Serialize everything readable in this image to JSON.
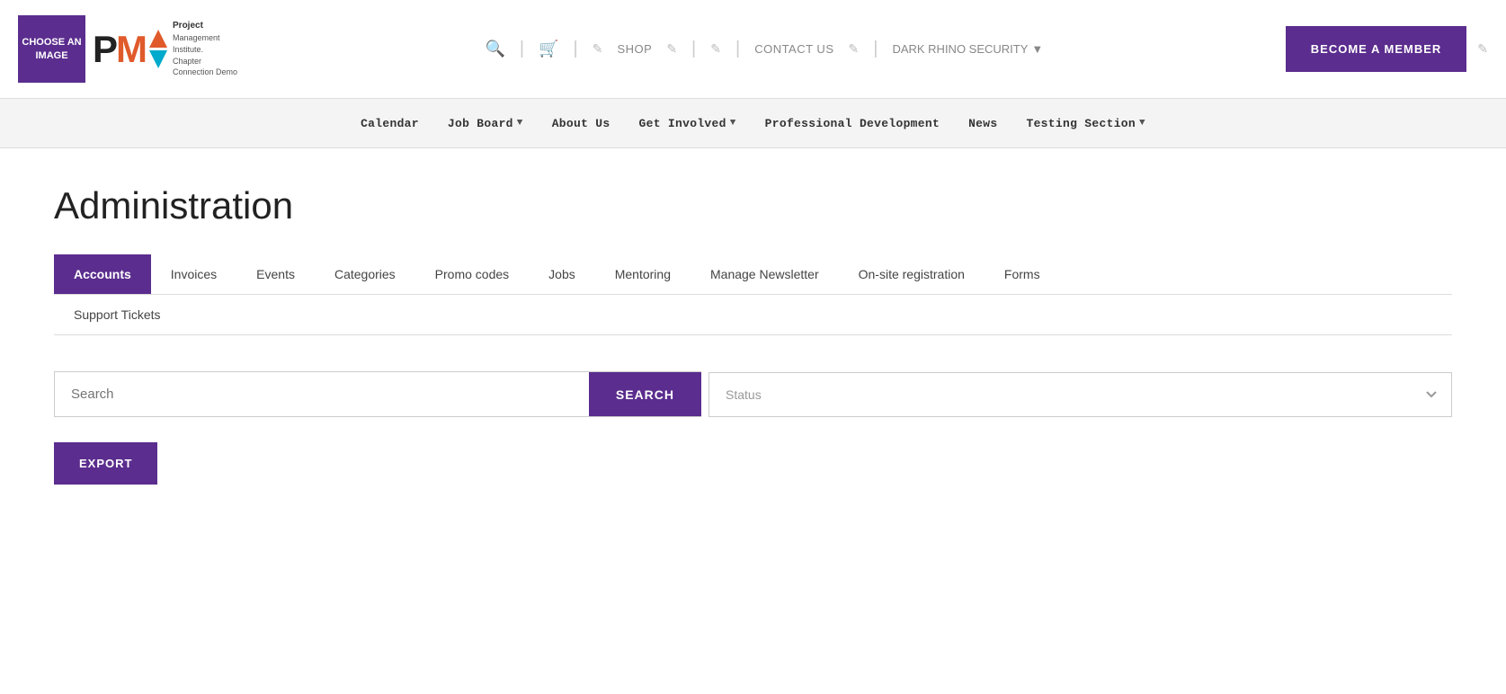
{
  "topbar": {
    "choose_image_label": "CHOOSE AN IMAGE",
    "logo_p": "P",
    "logo_m": "M",
    "logo_line1": "Project",
    "logo_line2": "Management",
    "logo_line3": "Institute.",
    "logo_line4": "Chapter",
    "logo_line5": "Connection Demo",
    "shop_label": "SHOP",
    "contact_label": "CONTACT US",
    "dropdown_label": "DARK RHINO SECURITY",
    "become_member_label": "BECOME A MEMBER"
  },
  "nav": {
    "items": [
      {
        "label": "Calendar",
        "has_dropdown": false
      },
      {
        "label": "Job Board",
        "has_dropdown": true
      },
      {
        "label": "About Us",
        "has_dropdown": false
      },
      {
        "label": "Get Involved",
        "has_dropdown": true
      },
      {
        "label": "Professional Development",
        "has_dropdown": false
      },
      {
        "label": "News",
        "has_dropdown": false
      },
      {
        "label": "Testing Section",
        "has_dropdown": true
      }
    ]
  },
  "page": {
    "title": "Administration"
  },
  "tabs": {
    "row1": [
      {
        "label": "Accounts",
        "active": true
      },
      {
        "label": "Invoices",
        "active": false
      },
      {
        "label": "Events",
        "active": false
      },
      {
        "label": "Categories",
        "active": false
      },
      {
        "label": "Promo codes",
        "active": false
      },
      {
        "label": "Jobs",
        "active": false
      },
      {
        "label": "Mentoring",
        "active": false
      },
      {
        "label": "Manage Newsletter",
        "active": false
      },
      {
        "label": "On-site registration",
        "active": false
      },
      {
        "label": "Forms",
        "active": false
      }
    ],
    "row2": [
      {
        "label": "Support Tickets",
        "active": false
      }
    ]
  },
  "search": {
    "placeholder": "Search",
    "button_label": "SEARCH",
    "status_placeholder": "Status"
  },
  "export": {
    "button_label": "EXPORT"
  }
}
